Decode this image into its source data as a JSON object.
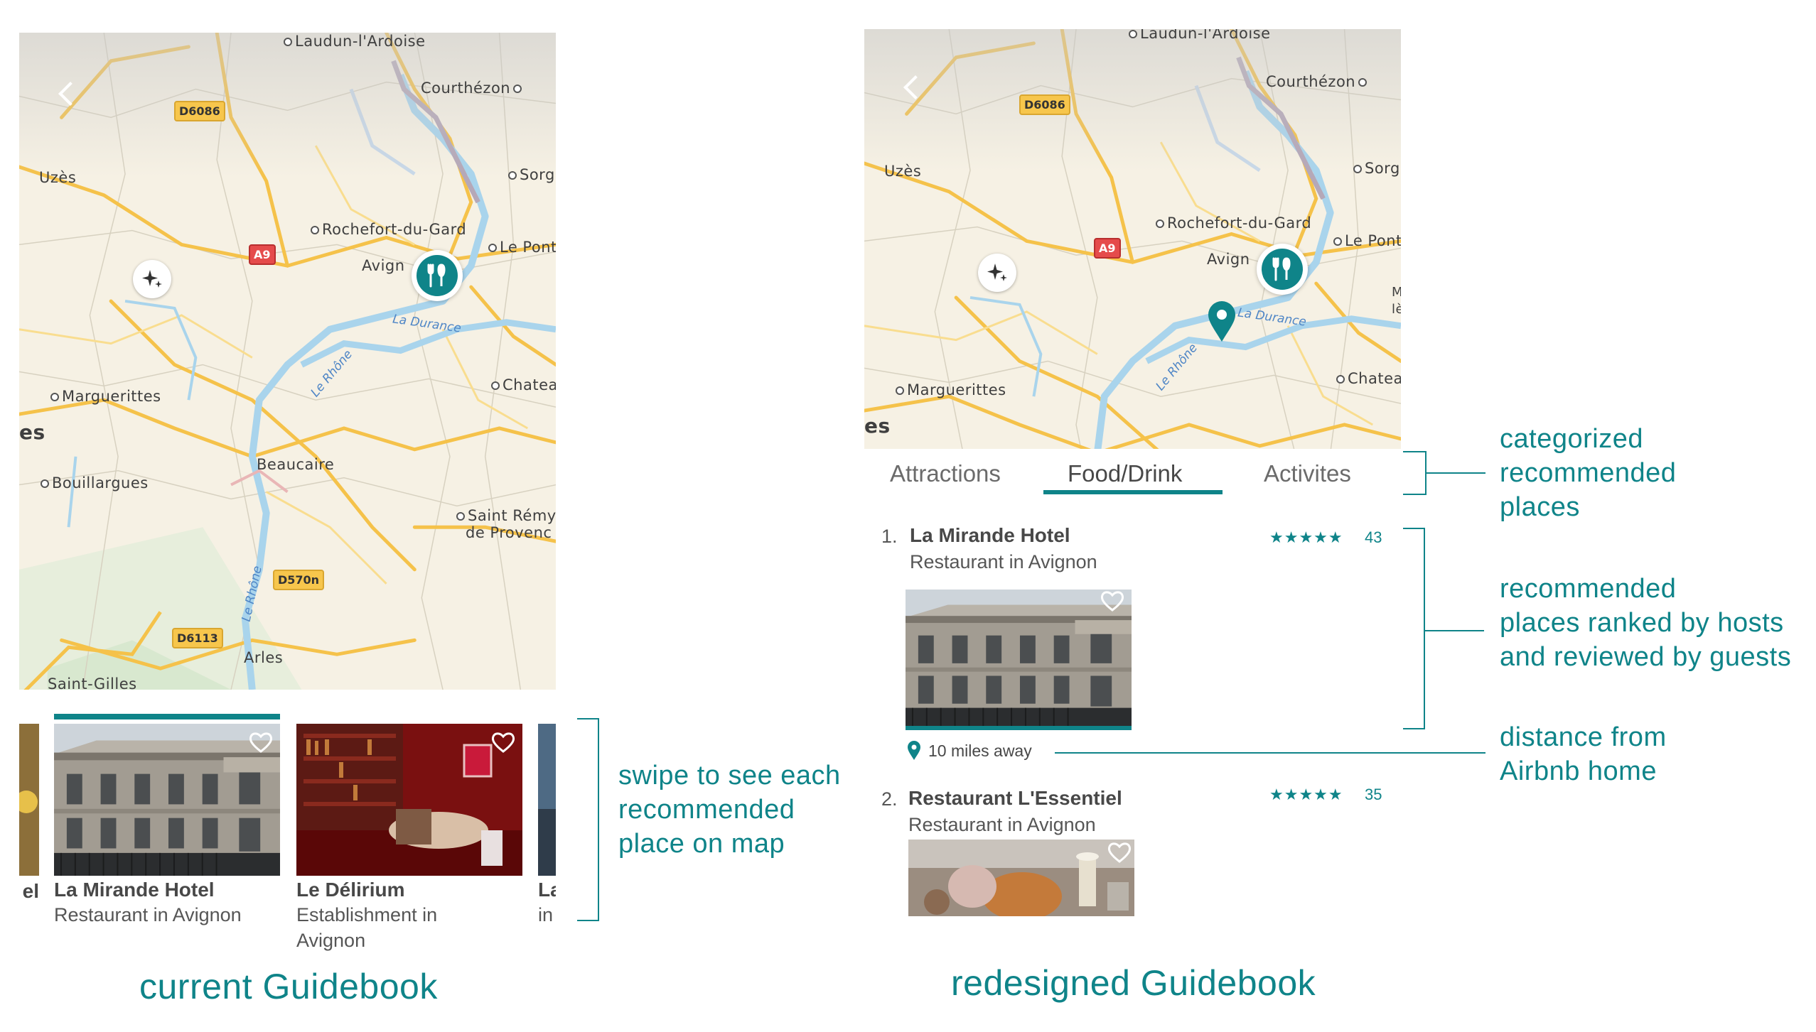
{
  "map": {
    "towns": [
      "Laudun-l'Ardoise",
      "Courthézon",
      "Uzès",
      "Sorgu",
      "Rochefort-du-Gard",
      "Le Pont",
      "Avign",
      "Chateau",
      "Marguerittes",
      "Beaucaire",
      "Bouillargues",
      "Saint Rémy",
      "de Provenc",
      "Arles",
      "Saint-Gilles",
      "es",
      "M",
      "lè"
    ],
    "rivers": [
      "La Durance",
      "Le Rhône",
      "Le Rhône"
    ],
    "road_shields": [
      "D6086",
      "A9",
      "D570n",
      "D6113"
    ]
  },
  "current": {
    "cards": [
      {
        "title": "La Mirande Hotel",
        "subtitle": "Restaurant in Avignon"
      },
      {
        "title": "Le Délirium",
        "subtitle_line1": "Establishment in",
        "subtitle_line2": "Avignon"
      }
    ],
    "partial_left_title": "el",
    "partial_right_title": "La",
    "partial_right_sub": "in",
    "annotation": "swipe to see each\nrecommended\nplace on map",
    "caption": "current Guidebook"
  },
  "redesigned": {
    "tabs": [
      "Attractions",
      "Food/Drink",
      "Activites"
    ],
    "active_tab": "Food/Drink",
    "places": [
      {
        "rank": "1.",
        "title": "La Mirande Hotel",
        "subtitle": "Restaurant in Avignon",
        "stars": "★★★★★",
        "reviews": "43",
        "distance": "10 miles away"
      },
      {
        "rank": "2.",
        "title": "Restaurant L'Essentiel",
        "subtitle": "Restaurant in Avignon",
        "stars": "★★★★★",
        "reviews": "35"
      }
    ],
    "annotations": {
      "tabs": "categorized\nrecommended\nplaces",
      "ranking": "recommended\nplaces ranked by hosts\nand reviewed  by guests",
      "distance": "distance from\nAirbnb home"
    },
    "caption": "redesigned Guidebook"
  },
  "colors": {
    "accent": "#0f8489",
    "text": "#484848",
    "map_bg": "#f6f1e4",
    "road": "#f5c24a",
    "river": "#a9d4ec"
  }
}
